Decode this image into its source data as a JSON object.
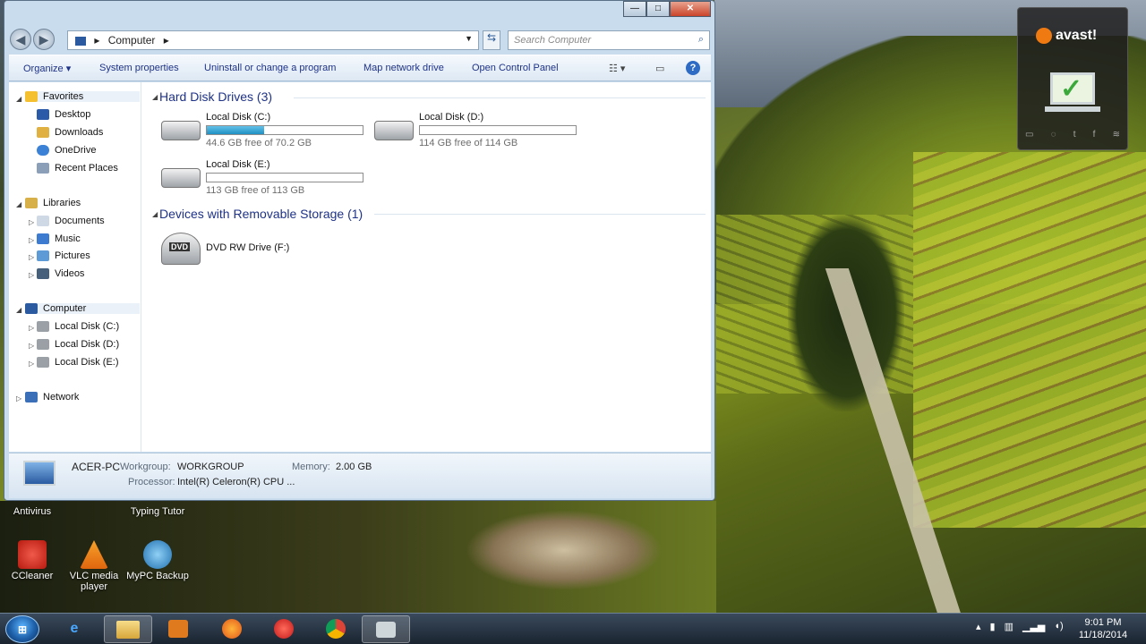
{
  "window": {
    "controls": {
      "minimize": "—",
      "maximize": "□",
      "close": "✕"
    },
    "address": {
      "root_icon": "computer-icon",
      "path": "Computer",
      "arrow": "▸"
    },
    "search_placeholder": "Search Computer"
  },
  "toolbar": {
    "organize": "Organize",
    "system_properties": "System properties",
    "uninstall": "Uninstall or change a program",
    "map_drive": "Map network drive",
    "control_panel": "Open Control Panel"
  },
  "nav": {
    "favorites": "Favorites",
    "desktop": "Desktop",
    "downloads": "Downloads",
    "onedrive": "OneDrive",
    "recent": "Recent Places",
    "libraries": "Libraries",
    "documents": "Documents",
    "music": "Music",
    "pictures": "Pictures",
    "videos": "Videos",
    "computer": "Computer",
    "disk_c": "Local Disk (C:)",
    "disk_d": "Local Disk (D:)",
    "disk_e": "Local Disk (E:)",
    "network": "Network"
  },
  "content": {
    "hdd_group": "Hard Disk Drives (3)",
    "removable_group": "Devices with Removable Storage (1)",
    "drives": [
      {
        "name": "Local Disk (C:)",
        "free": "44.6 GB free of 70.2 GB",
        "used_fraction": 0.365
      },
      {
        "name": "Local Disk (D:)",
        "free": "114 GB free of 114 GB",
        "used_fraction": 0.0
      },
      {
        "name": "Local Disk (E:)",
        "free": "113 GB free of 113 GB",
        "used_fraction": 0.0
      }
    ],
    "dvd": {
      "name": "DVD RW Drive (F:)",
      "label": "DVD"
    }
  },
  "details": {
    "pc_name": "ACER-PC",
    "workgroup_label": "Workgroup:",
    "workgroup": "WORKGROUP",
    "memory_label": "Memory:",
    "memory": "2.00 GB",
    "processor_label": "Processor:",
    "processor": "Intel(R) Celeron(R) CPU ..."
  },
  "desktop": {
    "antivirus": "Antivirus",
    "typing_tutor": "Typing Tutor",
    "ccleaner": "CCleaner",
    "vlc": "VLC media player",
    "mypc": "MyPC Backup"
  },
  "avast": {
    "brand": "avast!"
  },
  "taskbar": {
    "time": "9:01 PM",
    "date": "11/18/2014"
  },
  "colors": {
    "accent": "#1e3287",
    "drive_fill": "#1f8fc2",
    "window_frame": "#c9dcee"
  }
}
